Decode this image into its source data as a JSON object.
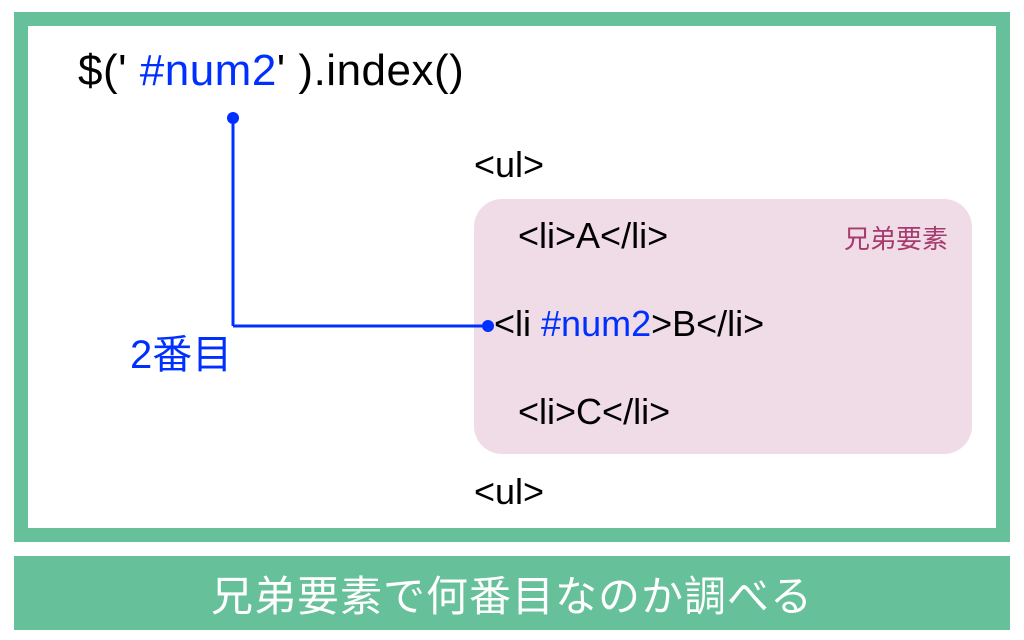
{
  "code": {
    "prefix": "$(' ",
    "selector": "#num2",
    "suffix": "' ).index()"
  },
  "structure": {
    "ul_open": "<ul>",
    "ul_close": "<ul>",
    "siblings_label": "兄弟要素",
    "li_a": "<li>A</li>",
    "li_b_open": "<li ",
    "li_b_id": "#num2",
    "li_b_close": ">B</li>",
    "li_c": "<li>C</li>"
  },
  "result_label": "2番目",
  "footer": "兄弟要素で何番目なのか調べる",
  "colors": {
    "accent_green": "#66c099",
    "selector_blue": "#0030ff",
    "siblings_bg": "#f0dce7",
    "siblings_text": "#a63a6e"
  }
}
